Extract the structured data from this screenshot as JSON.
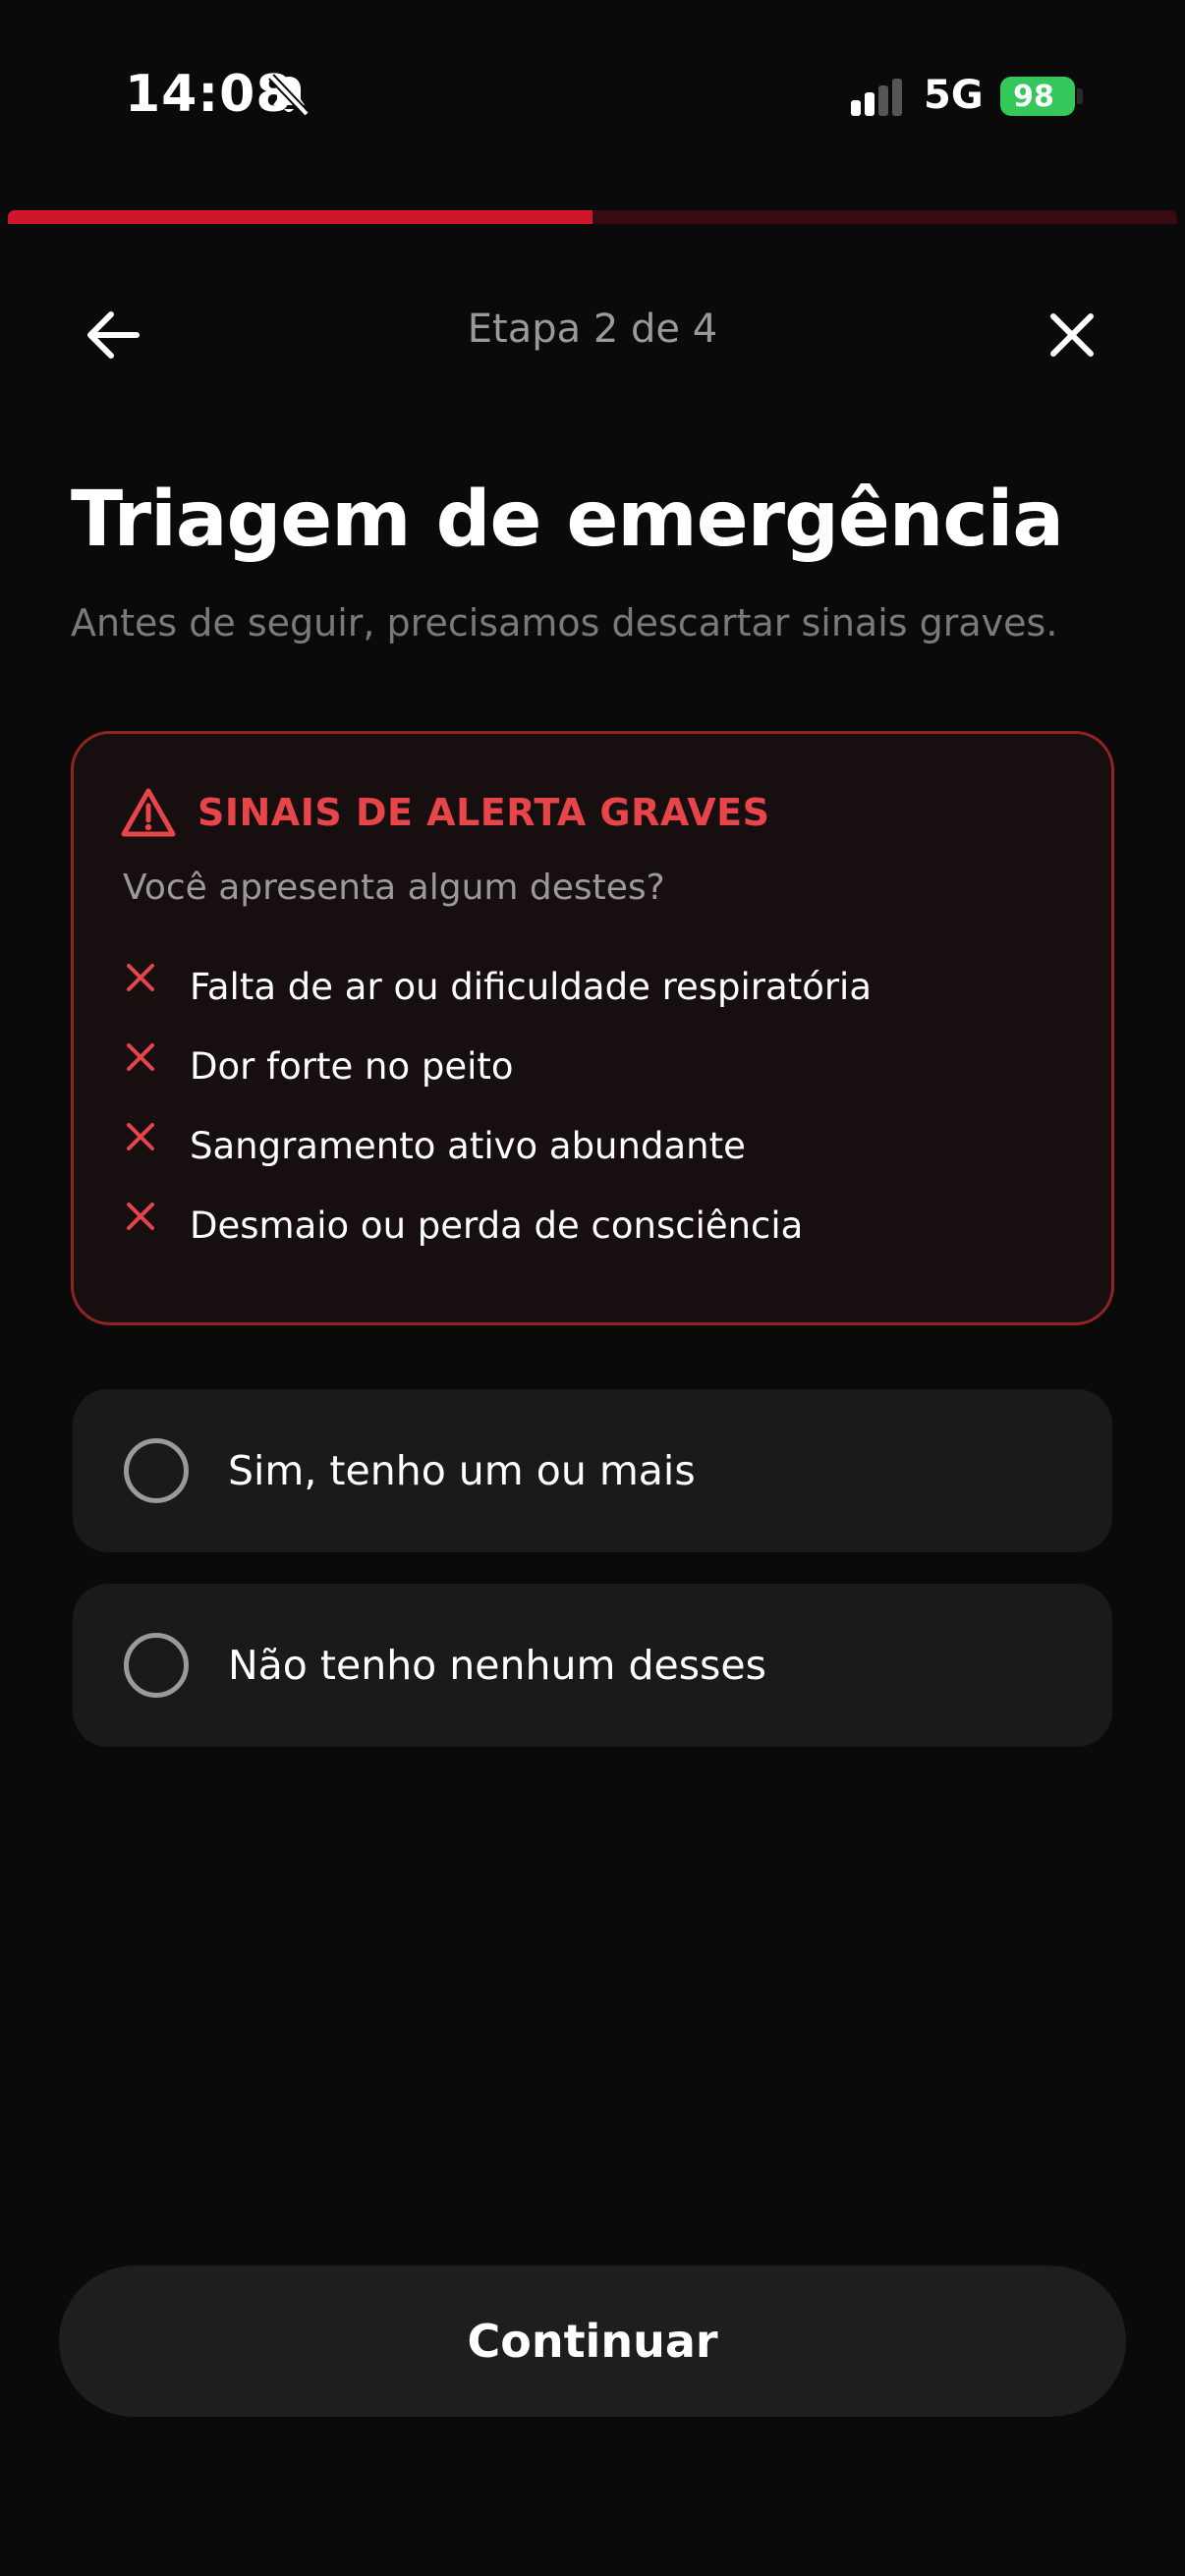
{
  "status_bar": {
    "time": "14:08",
    "network": "5G",
    "battery": "98"
  },
  "progress": {
    "current_step": 2,
    "total_steps": 4,
    "fraction": 0.5
  },
  "header": {
    "step_label": "Etapa 2 de 4",
    "back_icon": "arrow-left-icon",
    "close_icon": "close-icon"
  },
  "page": {
    "title": "Triagem de emergência",
    "subtitle": "Antes de seguir, precisamos descartar sinais graves."
  },
  "alert": {
    "title": "SINAIS DE ALERTA GRAVES",
    "question": "Você apresenta algum destes?",
    "symptoms": [
      "Falta de ar ou dificuldade respiratória",
      "Dor forte no peito",
      "Sangramento ativo abundante",
      "Desmaio ou perda de consciência"
    ],
    "accent_color": "#e8454a"
  },
  "options": [
    {
      "label": "Sim, tenho um ou mais",
      "selected": false
    },
    {
      "label": "Não tenho nenhum desses",
      "selected": false
    }
  ],
  "continue_label": "Continuar"
}
